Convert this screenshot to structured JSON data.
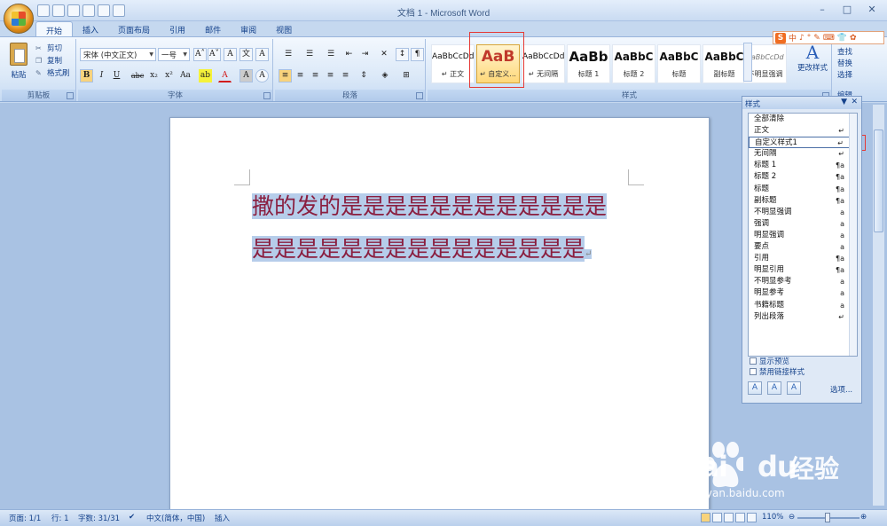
{
  "window": {
    "title": "文档 1 - Microsoft Word",
    "controls": {
      "minimize": "–",
      "maximize": "□",
      "close": "✕"
    }
  },
  "tabs": [
    "开始",
    "插入",
    "页面布局",
    "引用",
    "邮件",
    "审阅",
    "视图"
  ],
  "ribbon": {
    "clipboard": {
      "paste": "粘贴",
      "cut": "剪切",
      "copy": "复制",
      "format_painter": "格式刷",
      "label": "剪贴板"
    },
    "font": {
      "font_name": "宋体 (中文正文)",
      "font_size": "一号",
      "label": "字体",
      "buttons": {
        "bold": "B",
        "italic": "I",
        "underline": "U",
        "strike": "abc",
        "subscript": "x₂",
        "superscript": "x²",
        "change_case": "Aa",
        "grow": "A˄",
        "shrink": "A˅",
        "clear": "A",
        "phonetic": "文",
        "border": "A",
        "highlight": "ab",
        "color": "A",
        "shading": "A",
        "enclose": "A"
      }
    },
    "paragraph": {
      "label": "段落"
    },
    "styles": {
      "label": "样式",
      "gallery": [
        {
          "sample": "AaBbCcDd",
          "name": "↵ 正文"
        },
        {
          "sample": "AaB",
          "name": "↵ 自定义..."
        },
        {
          "sample": "AaBbCcDd",
          "name": "↵ 无间隔"
        },
        {
          "sample": "AaBb",
          "name": "标题 1"
        },
        {
          "sample": "AaBbC",
          "name": "标题 2"
        },
        {
          "sample": "AaBbC",
          "name": "标题"
        },
        {
          "sample": "AaBbC",
          "name": "副标题"
        },
        {
          "sample": "AaBbCcDd",
          "name": "不明显强调"
        }
      ],
      "change_styles": "更改样式"
    },
    "editing": {
      "find": "查找",
      "replace": "替换",
      "select": "选择",
      "label": "编辑"
    }
  },
  "ime_bar": {
    "logo": "S",
    "items": [
      "中",
      "♪",
      "°",
      "✎",
      "⌨",
      "👕",
      "✿",
      "✦"
    ]
  },
  "document": {
    "text": "撒的发的是是是是是是是是是是是是是是是是是是是是是是是是是是是"
  },
  "styles_pane": {
    "title": "样式",
    "items": [
      {
        "name": "全部清除",
        "mark": ""
      },
      {
        "name": "正文",
        "mark": "↵"
      },
      {
        "name": "自定义样式1",
        "mark": "↵"
      },
      {
        "name": "无间隔",
        "mark": "↵"
      },
      {
        "name": "标题 1",
        "mark": "¶a"
      },
      {
        "name": "标题 2",
        "mark": "¶a"
      },
      {
        "name": "标题",
        "mark": "¶a"
      },
      {
        "name": "副标题",
        "mark": "¶a"
      },
      {
        "name": "不明显强调",
        "mark": "a"
      },
      {
        "name": "强调",
        "mark": "a"
      },
      {
        "name": "明显强调",
        "mark": "a"
      },
      {
        "name": "要点",
        "mark": "a"
      },
      {
        "name": "引用",
        "mark": "¶a"
      },
      {
        "name": "明显引用",
        "mark": "¶a"
      },
      {
        "name": "不明显参考",
        "mark": "a"
      },
      {
        "name": "明显参考",
        "mark": "a"
      },
      {
        "name": "书籍标题",
        "mark": "a"
      },
      {
        "name": "列出段落",
        "mark": "↵"
      }
    ],
    "show_preview": "显示预览",
    "disable_linked": "禁用链接样式",
    "options": "选项..."
  },
  "statusbar": {
    "page": "页面: 1/1",
    "line": "行: 1",
    "words": "字数: 31/31",
    "language": "中文(简体，中国)",
    "mode": "插入",
    "zoom": "110%"
  },
  "watermark": {
    "brand": "Bai",
    "brand_tail": "du",
    "brand_cn": "经验",
    "url": "jingyan.baidu.com"
  },
  "colors": {
    "ribbon": "#dce9f8",
    "selection": "#b6cdea",
    "doc_text": "#8a1e3f",
    "annotation": "#e53935"
  }
}
